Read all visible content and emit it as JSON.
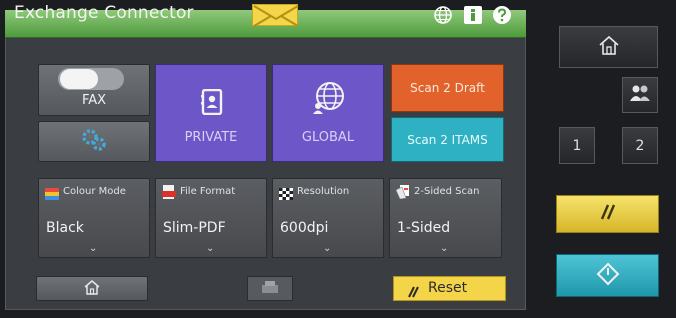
{
  "window": {
    "title": "Exchange Connector"
  },
  "header_icons": [
    "envelope-icon",
    "globe-icon",
    "info-icon",
    "help-icon"
  ],
  "main": {
    "fax_label": "FAX",
    "private_label": "PRIVATE",
    "global_label": "GLOBAL",
    "scan_draft_label": "Scan 2 Draft",
    "scan_itams_label": "Scan 2 ITAMS"
  },
  "settings": [
    {
      "label": "Colour Mode",
      "value": "Black"
    },
    {
      "label": "File Format",
      "value": "Slim-PDF"
    },
    {
      "label": "Resolution",
      "value": "600dpi"
    },
    {
      "label": "2-Sided Scan",
      "value": "1-Sided"
    }
  ],
  "footer": {
    "reset_label": "Reset"
  },
  "hardware": {
    "key1": "1",
    "key2": "2"
  },
  "colors": {
    "titlebar": "#5aa548",
    "private_global": "#6c56c8",
    "scan_draft": "#e2622c",
    "scan_itams": "#2eb1c2",
    "reset": "#f4d54a",
    "stop": "#e9cf45",
    "start": "#2fb0c3"
  }
}
